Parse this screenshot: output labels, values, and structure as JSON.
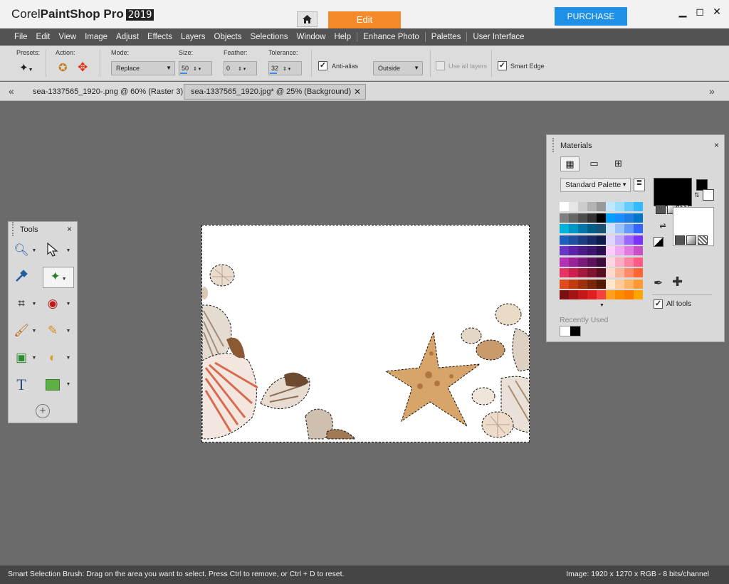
{
  "app": {
    "brand": "Corel",
    "product": "PaintShop",
    "suffix": "Pro",
    "year": "2019",
    "edit_tab": "Edit",
    "purchase": "PURCHASE"
  },
  "menu": [
    "File",
    "Edit",
    "View",
    "Image",
    "Adjust",
    "Effects",
    "Layers",
    "Objects",
    "Selections",
    "Window",
    "Help",
    "Enhance Photo",
    "Palettes",
    "User Interface"
  ],
  "toolbar": {
    "presets_label": "Presets:",
    "action_label": "Action:",
    "mode_label": "Mode:",
    "mode_value": "Replace",
    "size_label": "Size:",
    "size_value": "50",
    "feather_label": "Feather:",
    "feather_value": "0",
    "tolerance_label": "Tolerance:",
    "tolerance_value": "32",
    "antialias_label": "Anti-alias",
    "antialias_checked": true,
    "outside_value": "Outside",
    "use_all_layers_label": "Use all layers",
    "smart_edge_label": "Smart Edge",
    "smart_edge_checked": true
  },
  "tabs": [
    {
      "label": "sea-1337565_1920-.png @  60% (Raster 3)",
      "active": false
    },
    {
      "label": "sea-1337565_1920.jpg* @  25% (Background)",
      "active": true
    }
  ],
  "tools_panel": {
    "title": "Tools",
    "close": "×"
  },
  "materials": {
    "title": "Materials",
    "close": "×",
    "palette_select": "Standard Palette",
    "recently_used_label": "Recently Used",
    "all_tools_label": "All tools",
    "all_tools_checked": true,
    "recent_colors": [
      "#ffffff",
      "#000000"
    ],
    "foreground": "#000000",
    "background": "#ffffff",
    "swatches": [
      [
        "#ffffff",
        "#e6e6e6",
        "#cccccc",
        "#b3b3b3",
        "#999999",
        "#bfe8ff",
        "#99ddff",
        "#66ccff",
        "#33bbff"
      ],
      [
        "#808080",
        "#666666",
        "#4d4d4d",
        "#333333",
        "#000000",
        "#00a0ff",
        "#1a8cff",
        "#1f7fe0",
        "#0077cc"
      ],
      [
        "#00b4d8",
        "#0096c7",
        "#0077a8",
        "#005f87",
        "#1a5276",
        "#cce0ff",
        "#99c2ff",
        "#6699ff",
        "#3366ff"
      ],
      [
        "#1f5fbf",
        "#1f4fa0",
        "#1e3c80",
        "#172b66",
        "#0f1a4d",
        "#e0d4ff",
        "#c2a8ff",
        "#9966ff",
        "#7a33ff"
      ],
      [
        "#6a35c7",
        "#5a23a8",
        "#4b1b8a",
        "#3c156d",
        "#2a0d4f",
        "#ffccff",
        "#f0a6f0",
        "#e07ae0",
        "#c94fc9"
      ],
      [
        "#b530b5",
        "#992299",
        "#7a1a7a",
        "#5c135c",
        "#3d0d3d",
        "#ffd6e0",
        "#ffadc2",
        "#ff85a3",
        "#ff5c85"
      ],
      [
        "#e63366",
        "#cc1f4d",
        "#a6193f",
        "#801330",
        "#590d22",
        "#ffd9cc",
        "#ffb399",
        "#ff8c66",
        "#ff6633"
      ],
      [
        "#e04a1a",
        "#c23a10",
        "#9e2f0d",
        "#7a240a",
        "#561906",
        "#ffe6cc",
        "#ffcc99",
        "#ffb366",
        "#ff9933"
      ],
      [
        "#7a1010",
        "#a31414",
        "#c21a1a",
        "#e02020",
        "#f54040",
        "#ff9f1c",
        "#ff8c00",
        "#ff7b00",
        "#ffa500"
      ]
    ]
  },
  "status": {
    "hint": "Smart Selection Brush: Drag on the area you want to select. Press Ctrl to remove, or Ctrl + D to reset.",
    "image_info": "Image:  1920 x 1270 x RGB - 8 bits/channel"
  }
}
